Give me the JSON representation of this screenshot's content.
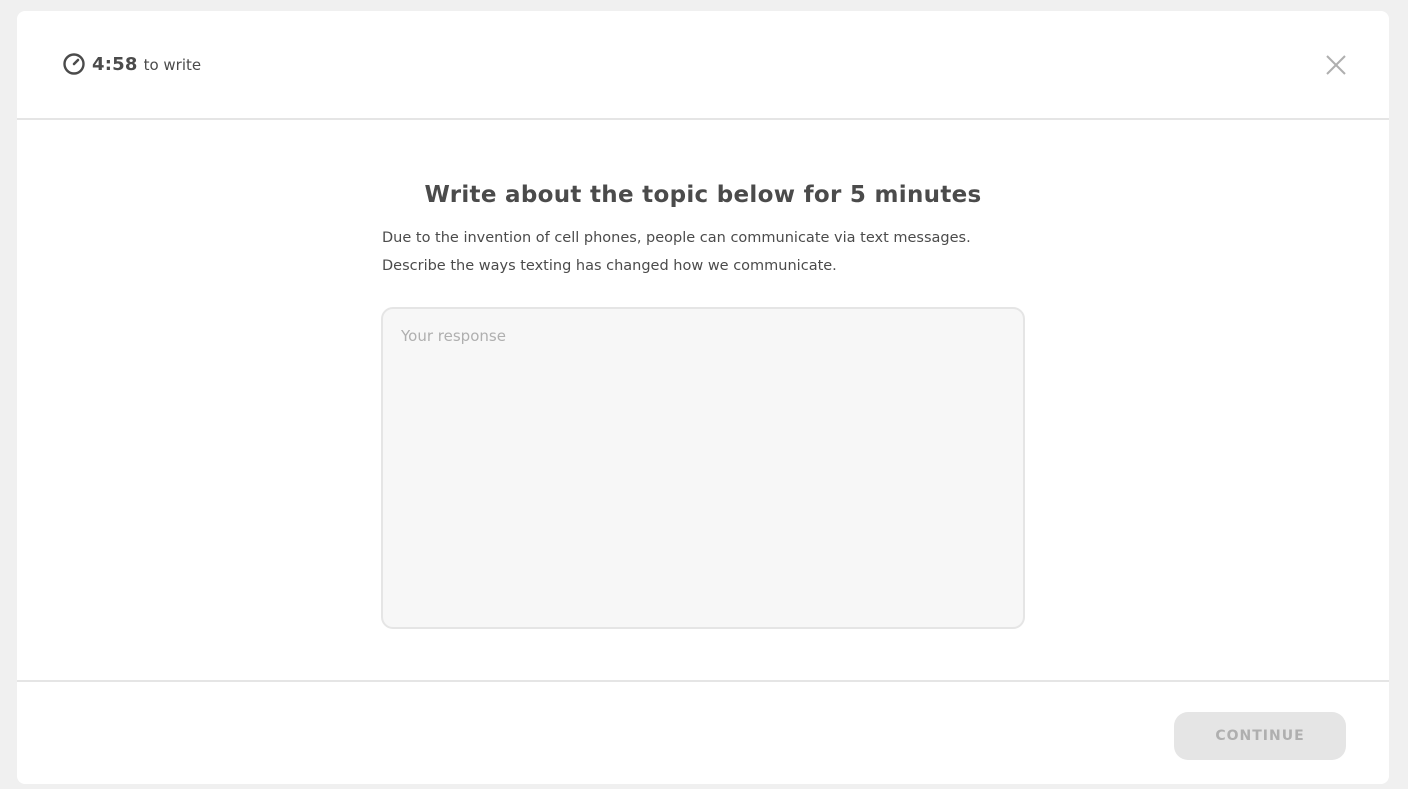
{
  "header": {
    "timer_value": "4:58",
    "timer_suffix": "to write",
    "timer_icon": "stopwatch-icon",
    "close_icon": "close-icon"
  },
  "main": {
    "heading": "Write about the topic below for 5 minutes",
    "prompt": "Due to the invention of cell phones, people can communicate via text messages. Describe the ways texting has changed how we communicate.",
    "response_placeholder": "Your response",
    "response_value": ""
  },
  "footer": {
    "continue_label": "CONTINUE"
  },
  "colors": {
    "text": "#4b4b4b",
    "placeholder": "#afafaf",
    "border": "#e5e5e5",
    "input_bg": "#f7f7f7",
    "disabled_button_bg": "#e5e5e5",
    "disabled_button_text": "#afafaf",
    "page_bg": "#f0f0f0"
  }
}
